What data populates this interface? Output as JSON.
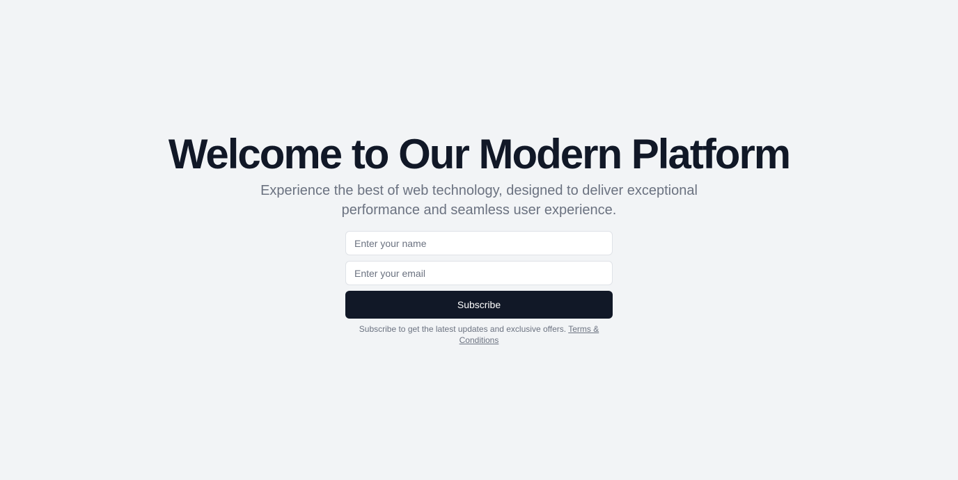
{
  "hero": {
    "title": "Welcome to Our Modern Platform",
    "subtitle": "Experience the best of web technology, designed to deliver exceptional performance and seamless user experience."
  },
  "form": {
    "name_placeholder": "Enter your name",
    "name_value": "",
    "email_placeholder": "Enter your email",
    "email_value": "",
    "subscribe_label": "Subscribe"
  },
  "footer": {
    "note": "Subscribe to get the latest updates and exclusive offers.",
    "terms_link": "Terms & Conditions"
  },
  "colors": {
    "background": "#f2f4f6",
    "heading": "#111827",
    "muted_text": "#6b7280",
    "button_bg": "#111827",
    "button_text": "#ffffff",
    "input_border": "#dfe2e7"
  }
}
